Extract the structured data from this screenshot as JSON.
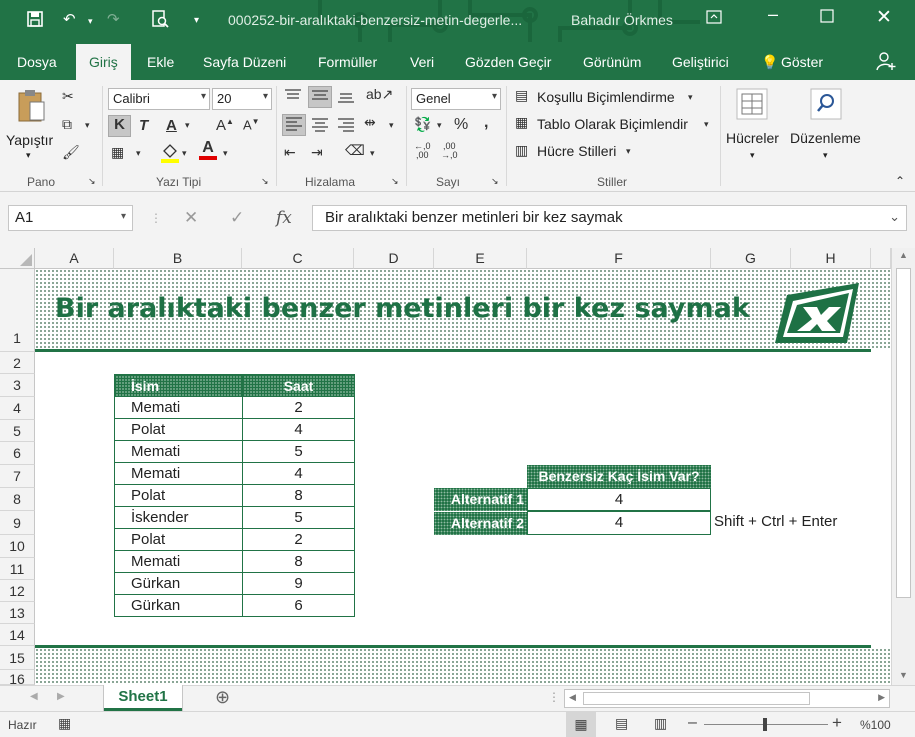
{
  "window": {
    "title": "000252-bir-aralıktaki-benzersiz-metin-degerle...",
    "user": "Bahadır Örkmes"
  },
  "menu": {
    "tabs": [
      "Dosya",
      "Giriş",
      "Ekle",
      "Sayfa Düzeni",
      "Formüller",
      "Veri",
      "Gözden Geçir",
      "Görünüm",
      "Geliştirici"
    ],
    "tell_me": "Göster"
  },
  "ribbon": {
    "paste": "Yapıştır",
    "font_name": "Calibri",
    "font_size": "20",
    "bold": "K",
    "italic": "T",
    "underline": "A",
    "number_format": "Genel",
    "conditional": "Koşullu Biçimlendirme",
    "format_table": "Tablo Olarak Biçimlendir",
    "cell_styles": "Hücre Stilleri",
    "cells": "Hücreler",
    "editing": "Düzenleme",
    "groups": {
      "clipboard": "Pano",
      "font": "Yazı Tipi",
      "alignment": "Hizalama",
      "number": "Sayı",
      "styles": "Stiller"
    }
  },
  "formula_bar": {
    "name_box": "A1",
    "formula": "Bir aralıktaki benzer metinleri bir kez saymak"
  },
  "columns": [
    "A",
    "B",
    "C",
    "D",
    "E",
    "F",
    "G",
    "H"
  ],
  "rows": [
    "1",
    "2",
    "3",
    "4",
    "5",
    "6",
    "7",
    "8",
    "9",
    "10",
    "11",
    "12",
    "13",
    "14",
    "15",
    "16"
  ],
  "sheet": {
    "title": "Bir aralıktaki benzer metinleri bir kez saymak",
    "table_headers": [
      "İsim",
      "Saat"
    ],
    "table_rows": [
      [
        "Memati",
        "2"
      ],
      [
        "Polat",
        "4"
      ],
      [
        "Memati",
        "5"
      ],
      [
        "Memati",
        "4"
      ],
      [
        "Polat",
        "8"
      ],
      [
        "İskender",
        "5"
      ],
      [
        "Polat",
        "2"
      ],
      [
        "Memati",
        "8"
      ],
      [
        "Gürkan",
        "9"
      ],
      [
        "Gürkan",
        "6"
      ]
    ],
    "result_header": "Benzersiz Kaç İsim Var?",
    "alt1_label": "Alternatif 1",
    "alt1_value": "4",
    "alt2_label": "Alternatif 2",
    "alt2_value": "4",
    "note": "Shift + Ctrl + Enter"
  },
  "tabs": {
    "sheet1": "Sheet1"
  },
  "status": {
    "ready": "Hazır",
    "zoom": "%100"
  },
  "colors": {
    "accent": "#217346",
    "title_green": "#1e7145"
  }
}
